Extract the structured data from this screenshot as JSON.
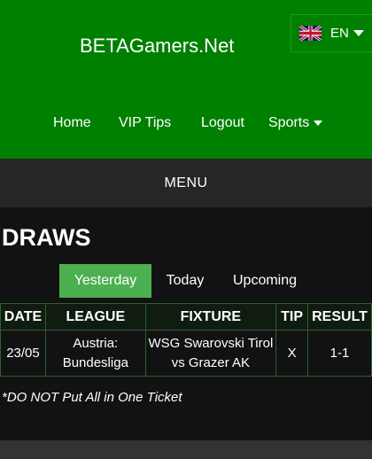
{
  "header": {
    "brand": "BETAGamers.Net",
    "language": {
      "code": "EN",
      "flag_icon": "uk-flag-icon"
    },
    "nav": [
      {
        "label": "Home"
      },
      {
        "label": "VIP Tips"
      },
      {
        "label": "Logout"
      },
      {
        "label": "Sports",
        "has_dropdown": true
      }
    ],
    "background_color": "#008000"
  },
  "menu": {
    "label": "MENU"
  },
  "section": {
    "title": "DRAWS"
  },
  "tabs": [
    {
      "label": "Yesterday",
      "active": true
    },
    {
      "label": "Today",
      "active": false
    },
    {
      "label": "Upcoming",
      "active": false
    }
  ],
  "table": {
    "columns": [
      "DATE",
      "LEAGUE",
      "FIXTURE",
      "TIP",
      "RESULT"
    ],
    "rows": [
      {
        "date": "23/05",
        "league": "Austria: Bundesliga",
        "fixture": "WSG Swarovski Tirol vs Grazer AK",
        "tip": "X",
        "result": "1-1"
      }
    ]
  },
  "disclaimer": "*DO NOT Put All in One Ticket",
  "colors": {
    "accent": "#4caf50",
    "header": "#008000",
    "menu_bar": "#262626",
    "page": "#121212"
  }
}
